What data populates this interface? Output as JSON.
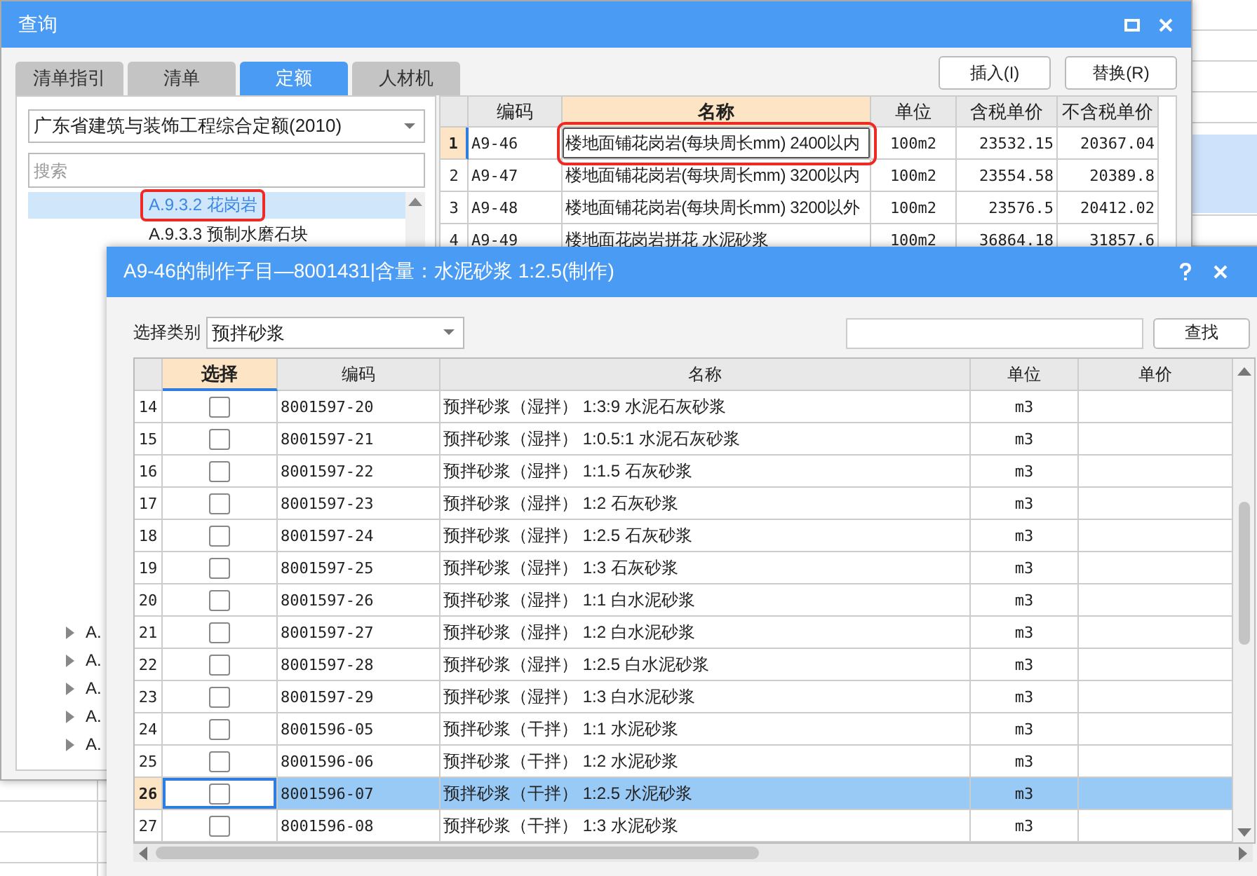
{
  "back_window": {
    "title": "查询",
    "tabs": [
      {
        "label": "清单指引",
        "selected": false
      },
      {
        "label": "清单",
        "selected": false
      },
      {
        "label": "定额",
        "selected": true
      },
      {
        "label": "人材机",
        "selected": false
      }
    ],
    "buttons": [
      "插入(I)",
      "替换(R)"
    ],
    "quota_dropdown": {
      "value": "广东省建筑与装饰工程综合定额(2010)"
    },
    "search": {
      "placeholder": "搜索"
    },
    "tree": {
      "items": [
        {
          "label": "A.9.3.2 花岗岩",
          "selected": true,
          "annotated": true
        },
        {
          "label": "A.9.3.3 预制水磨石块",
          "selected": false,
          "annotated": false
        }
      ],
      "top_level": [
        {
          "label": "A.",
          "expanded": false
        },
        {
          "label": "A.",
          "expanded": false
        },
        {
          "label": "A.",
          "expanded": false
        },
        {
          "label": "A.",
          "expanded": false
        },
        {
          "label": "A.",
          "expanded": false
        }
      ]
    },
    "table": {
      "columns": [
        "编码",
        "名称",
        "单位",
        "含税单价",
        "不含税单价"
      ],
      "rows": [
        {
          "num": "1",
          "cells": [
            "A9-46",
            "楼地面铺花岗岩(每块周长mm) 2400以内",
            "100m2",
            "23532.15",
            "20367.04"
          ],
          "selected": true,
          "annotated": true
        },
        {
          "num": "2",
          "cells": [
            "A9-47",
            "楼地面铺花岗岩(每块周长mm) 3200以内",
            "100m2",
            "23554.58",
            "20389.8"
          ],
          "selected": false,
          "annotated": false
        },
        {
          "num": "3",
          "cells": [
            "A9-48",
            "楼地面铺花岗岩(每块周长mm) 3200以外",
            "100m2",
            "23576.5",
            "20412.02"
          ],
          "selected": false,
          "annotated": false
        },
        {
          "num": "4",
          "cells": [
            "A9-49",
            "楼地面花岗岩拼花 水泥砂浆",
            "100m2",
            "36864.18",
            "31857.6"
          ],
          "selected": false,
          "annotated": false
        }
      ]
    }
  },
  "dialog": {
    "title": "A9-46的制作子目—8001431|含量：水泥砂浆 1:2.5(制作)",
    "category_label": "选择类别",
    "category": {
      "value": "预拌砂浆"
    },
    "find_button": "查找",
    "table": {
      "columns": [
        "选择",
        "编码",
        "名称",
        "单位",
        "单价"
      ],
      "rows": [
        {
          "num": "14",
          "checked": false,
          "code": "8001597-20",
          "name": "预拌砂浆（湿拌） 1:3:9 水泥石灰砂浆",
          "unit": "m3",
          "selected": false
        },
        {
          "num": "15",
          "checked": false,
          "code": "8001597-21",
          "name": "预拌砂浆（湿拌） 1:0.5:1 水泥石灰砂浆",
          "unit": "m3",
          "selected": false
        },
        {
          "num": "16",
          "checked": false,
          "code": "8001597-22",
          "name": "预拌砂浆（湿拌） 1:1.5 石灰砂浆",
          "unit": "m3",
          "selected": false
        },
        {
          "num": "17",
          "checked": false,
          "code": "8001597-23",
          "name": "预拌砂浆（湿拌） 1:2 石灰砂浆",
          "unit": "m3",
          "selected": false
        },
        {
          "num": "18",
          "checked": false,
          "code": "8001597-24",
          "name": "预拌砂浆（湿拌） 1:2.5 石灰砂浆",
          "unit": "m3",
          "selected": false
        },
        {
          "num": "19",
          "checked": false,
          "code": "8001597-25",
          "name": "预拌砂浆（湿拌） 1:3 石灰砂浆",
          "unit": "m3",
          "selected": false
        },
        {
          "num": "20",
          "checked": false,
          "code": "8001597-26",
          "name": "预拌砂浆（湿拌） 1:1 白水泥砂浆",
          "unit": "m3",
          "selected": false
        },
        {
          "num": "21",
          "checked": false,
          "code": "8001597-27",
          "name": "预拌砂浆（湿拌） 1:2 白水泥砂浆",
          "unit": "m3",
          "selected": false
        },
        {
          "num": "22",
          "checked": false,
          "code": "8001597-28",
          "name": "预拌砂浆（湿拌） 1:2.5 白水泥砂浆",
          "unit": "m3",
          "selected": false
        },
        {
          "num": "23",
          "checked": false,
          "code": "8001597-29",
          "name": "预拌砂浆（湿拌） 1:3 白水泥砂浆",
          "unit": "m3",
          "selected": false
        },
        {
          "num": "24",
          "checked": false,
          "code": "8001596-05",
          "name": "预拌砂浆（干拌） 1:1 水泥砂浆",
          "unit": "m3",
          "selected": false
        },
        {
          "num": "25",
          "checked": false,
          "code": "8001596-06",
          "name": "预拌砂浆（干拌） 1:2 水泥砂浆",
          "unit": "m3",
          "selected": false
        },
        {
          "num": "26",
          "checked": false,
          "code": "8001596-07",
          "name": "预拌砂浆（干拌） 1:2.5 水泥砂浆",
          "unit": "m3",
          "selected": true
        },
        {
          "num": "27",
          "checked": false,
          "code": "8001596-08",
          "name": "预拌砂浆（干拌） 1:3 水泥砂浆",
          "unit": "m3",
          "selected": false
        }
      ]
    }
  }
}
